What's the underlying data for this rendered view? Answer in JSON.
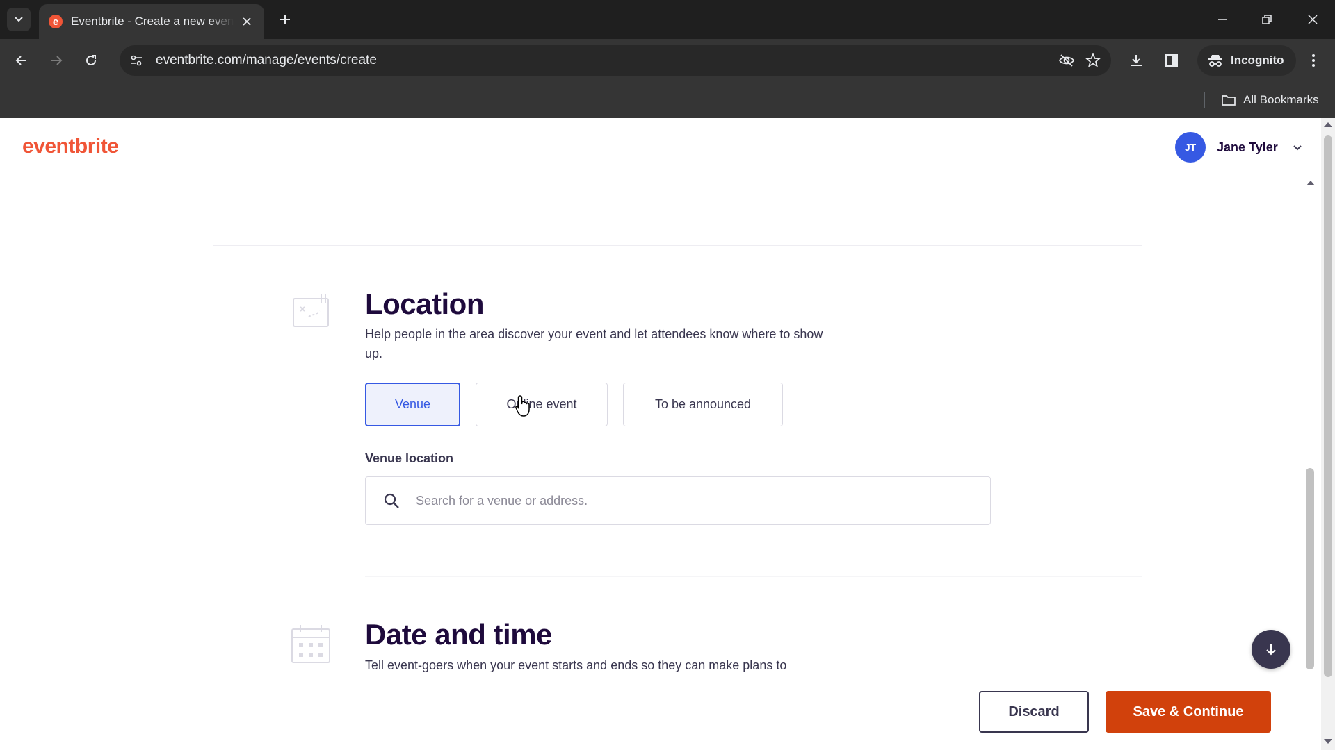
{
  "browser": {
    "tab_title": "Eventbrite - Create a new event",
    "tab_favicon_letter": "e",
    "url": "eventbrite.com/manage/events/create",
    "incognito_label": "Incognito",
    "bookmarks_label": "All Bookmarks"
  },
  "header": {
    "logo": "eventbrite",
    "user_initials": "JT",
    "user_name": "Jane Tyler"
  },
  "location": {
    "title": "Location",
    "description": "Help people in the area discover your event and let attendees know where to show up.",
    "options": [
      "Venue",
      "Online event",
      "To be announced"
    ],
    "selected": "Venue",
    "venue_label": "Venue location",
    "search_placeholder": "Search for a venue or address."
  },
  "datetime": {
    "title": "Date and time",
    "description": "Tell event-goers when your event starts and ends so they can make plans to"
  },
  "footer": {
    "discard_label": "Discard",
    "save_label": "Save & Continue"
  },
  "colors": {
    "brand": "#f05537",
    "primary_action": "#d1410c",
    "selected_blue": "#3659e3",
    "text_dark": "#1e0a3c"
  }
}
